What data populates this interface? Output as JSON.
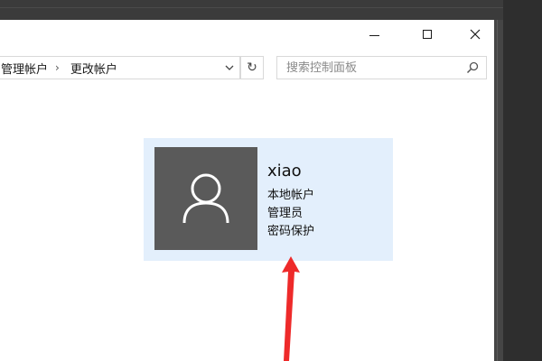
{
  "window": {
    "controls": {
      "minimize_icon": "minimize-icon",
      "maximize_icon": "maximize-icon",
      "close_icon": "close-icon"
    }
  },
  "address": {
    "crumbs": [
      "管理帐户",
      "更改帐户"
    ],
    "separator": "›",
    "refresh_glyph": "↻"
  },
  "search": {
    "placeholder": "搜索控制面板",
    "value": ""
  },
  "account": {
    "name": "xiao",
    "lines": [
      "本地帐户",
      "管理员",
      "密码保护"
    ],
    "avatar_icon": "user-icon"
  },
  "colors": {
    "card_bg": "#e3effc",
    "avatar_bg": "#5a5a5a",
    "arrow": "#ee2a2a",
    "desktop_dark": "#3a3a3a"
  }
}
